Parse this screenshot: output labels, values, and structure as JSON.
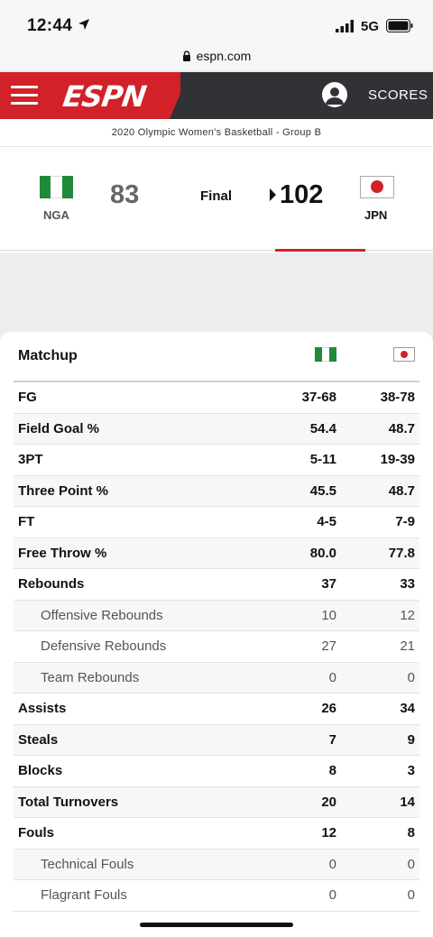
{
  "status_bar": {
    "time": "12:44",
    "network": "5G"
  },
  "browser": {
    "url": "espn.com"
  },
  "nav": {
    "logo": "ESPN",
    "scores_label": "SCORES"
  },
  "game": {
    "competition": "2020 Olympic Women's Basketball - Group B",
    "status": "Final",
    "away": {
      "abbr": "NGA",
      "score": "83",
      "flag_colors": [
        "#1f8a3a",
        "#ffffff",
        "#1f8a3a"
      ]
    },
    "home": {
      "abbr": "JPN",
      "score": "102",
      "flag_colors": [
        "#ffffff",
        "#d12229"
      ]
    }
  },
  "matchup": {
    "title": "Matchup",
    "rows": [
      {
        "label": "FG",
        "nga": "37-68",
        "jpn": "38-78",
        "sub": false
      },
      {
        "label": "Field Goal %",
        "nga": "54.4",
        "jpn": "48.7",
        "sub": false
      },
      {
        "label": "3PT",
        "nga": "5-11",
        "jpn": "19-39",
        "sub": false
      },
      {
        "label": "Three Point %",
        "nga": "45.5",
        "jpn": "48.7",
        "sub": false
      },
      {
        "label": "FT",
        "nga": "4-5",
        "jpn": "7-9",
        "sub": false
      },
      {
        "label": "Free Throw %",
        "nga": "80.0",
        "jpn": "77.8",
        "sub": false
      },
      {
        "label": "Rebounds",
        "nga": "37",
        "jpn": "33",
        "sub": false
      },
      {
        "label": "Offensive Rebounds",
        "nga": "10",
        "jpn": "12",
        "sub": true
      },
      {
        "label": "Defensive Rebounds",
        "nga": "27",
        "jpn": "21",
        "sub": true
      },
      {
        "label": "Team Rebounds",
        "nga": "0",
        "jpn": "0",
        "sub": true
      },
      {
        "label": "Assists",
        "nga": "26",
        "jpn": "34",
        "sub": false
      },
      {
        "label": "Steals",
        "nga": "7",
        "jpn": "9",
        "sub": false
      },
      {
        "label": "Blocks",
        "nga": "8",
        "jpn": "3",
        "sub": false
      },
      {
        "label": "Total Turnovers",
        "nga": "20",
        "jpn": "14",
        "sub": false
      },
      {
        "label": "Fouls",
        "nga": "12",
        "jpn": "8",
        "sub": false
      },
      {
        "label": "Technical Fouls",
        "nga": "0",
        "jpn": "0",
        "sub": true
      },
      {
        "label": "Flagrant Fouls",
        "nga": "0",
        "jpn": "0",
        "sub": true
      }
    ]
  },
  "colors": {
    "espn_red": "#d12229",
    "nav_dark": "#303236"
  }
}
